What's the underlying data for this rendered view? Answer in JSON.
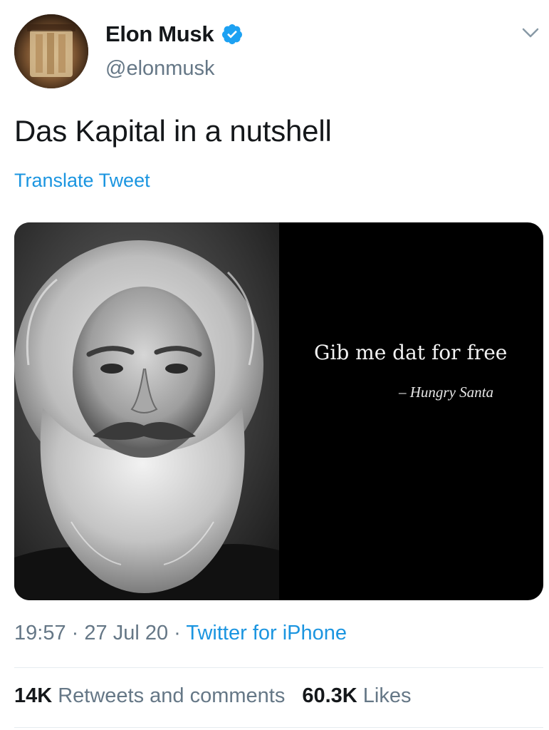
{
  "author": {
    "name": "Elon Musk",
    "handle": "@elonmusk",
    "verified_color": "#1da1f2"
  },
  "tweet": {
    "text": "Das Kapital in a nutshell",
    "translate_label": "Translate Tweet"
  },
  "media": {
    "quote": "Gib me dat for free",
    "attribution": "– Hungry Santa"
  },
  "meta": {
    "time": "19:57",
    "date": "27 Jul 20",
    "separator": "·",
    "source": "Twitter for iPhone"
  },
  "stats": {
    "retweets_count": "14K",
    "retweets_label": "Retweets and comments",
    "likes_count": "60.3K",
    "likes_label": "Likes"
  },
  "colors": {
    "link": "#1b95e0",
    "secondary_text": "#657786",
    "primary_text": "#14171a"
  },
  "icons": {
    "verified": "verified-badge-icon",
    "caret": "chevron-down-icon"
  }
}
